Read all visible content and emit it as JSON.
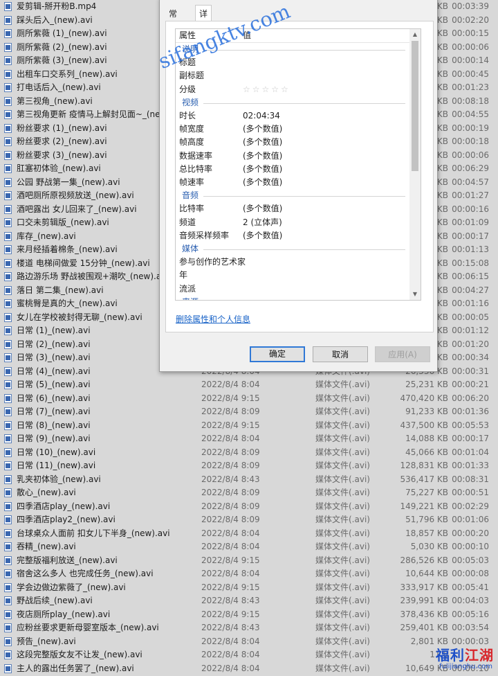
{
  "files": [
    {
      "name": "爱剪辑-掰开粉B.mp4",
      "date": "",
      "type": "",
      "size": "KB",
      "duration": "00:03:39"
    },
    {
      "name": "踩头后入_(new).avi",
      "date": "",
      "type": "",
      "size": "KB",
      "duration": "00:02:20"
    },
    {
      "name": "厕所紫薇 (1)_(new).avi",
      "date": "",
      "type": "",
      "size": "KB",
      "duration": "00:00:15"
    },
    {
      "name": "厕所紫薇 (2)_(new).avi",
      "date": "",
      "type": "",
      "size": "KB",
      "duration": "00:00:06"
    },
    {
      "name": "厕所紫薇 (3)_(new).avi",
      "date": "",
      "type": "",
      "size": "KB",
      "duration": "00:00:14"
    },
    {
      "name": "出租车口交系列_(new).avi",
      "date": "",
      "type": "",
      "size": "KB",
      "duration": "00:00:45"
    },
    {
      "name": "打电话后入_(new).avi",
      "date": "",
      "type": "",
      "size": "KB",
      "duration": "00:01:23"
    },
    {
      "name": "第三视角_(new).avi",
      "date": "",
      "type": "",
      "size": "KB",
      "duration": "00:08:18"
    },
    {
      "name": "第三视角更新 疫情马上解封见面~_(new).avi",
      "date": "",
      "type": "",
      "size": "KB",
      "duration": "00:04:55"
    },
    {
      "name": "粉丝要求 (1)_(new).avi",
      "date": "",
      "type": "",
      "size": "KB",
      "duration": "00:00:19"
    },
    {
      "name": "粉丝要求 (2)_(new).avi",
      "date": "",
      "type": "",
      "size": "KB",
      "duration": "00:00:18"
    },
    {
      "name": "粉丝要求 (3)_(new).avi",
      "date": "",
      "type": "",
      "size": "KB",
      "duration": "00:00:06"
    },
    {
      "name": "肛塞初体验_(new).avi",
      "date": "",
      "type": "",
      "size": "KB",
      "duration": "00:06:29"
    },
    {
      "name": "公园 野战第一集_(new).avi",
      "date": "",
      "type": "",
      "size": "KB",
      "duration": "00:04:57"
    },
    {
      "name": "酒吧厕所原视频放送_(new).avi",
      "date": "",
      "type": "",
      "size": "KB",
      "duration": "00:01:27"
    },
    {
      "name": "酒吧露出 女儿回来了_(new).avi",
      "date": "",
      "type": "",
      "size": "KB",
      "duration": "00:00:16"
    },
    {
      "name": "口交未剪辑版_(new).avi",
      "date": "",
      "type": "",
      "size": "KB",
      "duration": "00:01:09"
    },
    {
      "name": "库存_(new).avi",
      "date": "",
      "type": "",
      "size": "KB",
      "duration": "00:00:17"
    },
    {
      "name": "来月经插着棉条_(new).avi",
      "date": "",
      "type": "",
      "size": "KB",
      "duration": "00:01:13"
    },
    {
      "name": "楼道 电梯间做爱 15分钟_(new).avi",
      "date": "",
      "type": "",
      "size": "KB",
      "duration": "00:15:08"
    },
    {
      "name": "路边游乐场 野战被围观+潮吹_(new).avi",
      "date": "",
      "type": "",
      "size": "KB",
      "duration": "00:06:15"
    },
    {
      "name": "落日 第二集_(new).avi",
      "date": "",
      "type": "",
      "size": "KB",
      "duration": "00:04:27"
    },
    {
      "name": "蜜桃臀是真的大_(new).avi",
      "date": "",
      "type": "",
      "size": "KB",
      "duration": "00:01:16"
    },
    {
      "name": "女儿在学校被封得无聊_(new).avi",
      "date": "",
      "type": "",
      "size": "KB",
      "duration": "00:00:05"
    },
    {
      "name": "日常 (1)_(new).avi",
      "date": "",
      "type": "",
      "size": "KB",
      "duration": "00:01:12"
    },
    {
      "name": "日常 (2)_(new).avi",
      "date": "",
      "type": "",
      "size": "KB",
      "duration": "00:01:20"
    },
    {
      "name": "日常 (3)_(new).avi",
      "date": "",
      "type": "",
      "size": "KB",
      "duration": "00:00:34"
    },
    {
      "name": "日常 (4)_(new).avi",
      "date": "2022/8/4 8:04",
      "type": "媒体文件(.avi)",
      "size": "26,336 KB",
      "duration": "00:00:31"
    },
    {
      "name": "日常 (5)_(new).avi",
      "date": "2022/8/4 8:04",
      "type": "媒体文件(.avi)",
      "size": "25,231 KB",
      "duration": "00:00:21"
    },
    {
      "name": "日常 (6)_(new).avi",
      "date": "2022/8/4 9:15",
      "type": "媒体文件(.avi)",
      "size": "470,420 KB",
      "duration": "00:06:20"
    },
    {
      "name": "日常 (7)_(new).avi",
      "date": "2022/8/4 8:09",
      "type": "媒体文件(.avi)",
      "size": "91,233 KB",
      "duration": "00:01:36"
    },
    {
      "name": "日常 (8)_(new).avi",
      "date": "2022/8/4 9:15",
      "type": "媒体文件(.avi)",
      "size": "437,500 KB",
      "duration": "00:05:53"
    },
    {
      "name": "日常 (9)_(new).avi",
      "date": "2022/8/4 8:04",
      "type": "媒体文件(.avi)",
      "size": "14,088 KB",
      "duration": "00:00:17"
    },
    {
      "name": "日常 (10)_(new).avi",
      "date": "2022/8/4 8:09",
      "type": "媒体文件(.avi)",
      "size": "45,066 KB",
      "duration": "00:01:04"
    },
    {
      "name": "日常 (11)_(new).avi",
      "date": "2022/8/4 8:09",
      "type": "媒体文件(.avi)",
      "size": "128,831 KB",
      "duration": "00:01:33"
    },
    {
      "name": "乳夹初体验_(new).avi",
      "date": "2022/8/4 8:43",
      "type": "媒体文件(.avi)",
      "size": "536,417 KB",
      "duration": "00:08:31"
    },
    {
      "name": "散心_(new).avi",
      "date": "2022/8/4 8:09",
      "type": "媒体文件(.avi)",
      "size": "75,227 KB",
      "duration": "00:00:51"
    },
    {
      "name": "四季酒店play_(new).avi",
      "date": "2022/8/4 8:09",
      "type": "媒体文件(.avi)",
      "size": "149,221 KB",
      "duration": "00:02:29"
    },
    {
      "name": "四季酒店play2_(new).avi",
      "date": "2022/8/4 8:09",
      "type": "媒体文件(.avi)",
      "size": "51,796 KB",
      "duration": "00:01:06"
    },
    {
      "name": "台球桌众人面前 扣女儿下半身_(new).avi",
      "date": "2022/8/4 8:04",
      "type": "媒体文件(.avi)",
      "size": "18,857 KB",
      "duration": "00:00:20"
    },
    {
      "name": "吞精_(new).avi",
      "date": "2022/8/4 8:04",
      "type": "媒体文件(.avi)",
      "size": "5,030 KB",
      "duration": "00:00:10"
    },
    {
      "name": "完整版福利放送_(new).avi",
      "date": "2022/8/4 9:15",
      "type": "媒体文件(.avi)",
      "size": "286,526 KB",
      "duration": "00:05:03"
    },
    {
      "name": "宿舍这么多人 也完成任务_(new).avi",
      "date": "2022/8/4 8:04",
      "type": "媒体文件(.avi)",
      "size": "10,644 KB",
      "duration": "00:00:08"
    },
    {
      "name": "学会边做边紫薇了_(new).avi",
      "date": "2022/8/4 9:15",
      "type": "媒体文件(.avi)",
      "size": "333,917 KB",
      "duration": "00:05:41"
    },
    {
      "name": "野战后续_(new).avi",
      "date": "2022/8/4 8:43",
      "type": "媒体文件(.avi)",
      "size": "239,991 KB",
      "duration": "00:04:03"
    },
    {
      "name": "夜店厕所play_(new).avi",
      "date": "2022/8/4 9:15",
      "type": "媒体文件(.avi)",
      "size": "378,436 KB",
      "duration": "00:05:16"
    },
    {
      "name": "应粉丝要求更新母婴室版本_(new).avi",
      "date": "2022/8/4 8:43",
      "type": "媒体文件(.avi)",
      "size": "259,401 KB",
      "duration": "00:03:54"
    },
    {
      "name": "预告_(new).avi",
      "date": "2022/8/4 8:04",
      "type": "媒体文件(.avi)",
      "size": "2,801 KB",
      "duration": "00:00:03"
    },
    {
      "name": "这段完整版女友不让发_(new).avi",
      "date": "2022/8/4 8:04",
      "type": "媒体文件(.avi)",
      "size": "11,8",
      "duration": ""
    },
    {
      "name": "主人的露出任务罢了_(new).avi",
      "date": "2022/8/4 8:04",
      "type": "媒体文件(.avi)",
      "size": "10,649 KB",
      "duration": "00:00:10"
    }
  ],
  "dialog": {
    "tabs": [
      "常规",
      "详细信息"
    ],
    "active_tab": 1,
    "grid_header": {
      "property": "属性",
      "value": "值"
    },
    "rows": [
      {
        "kind": "section",
        "label": "说明"
      },
      {
        "kind": "prop",
        "name": "标题",
        "value": ""
      },
      {
        "kind": "prop",
        "name": "副标题",
        "value": ""
      },
      {
        "kind": "prop",
        "name": "分级",
        "value": "",
        "stars": "☆☆☆☆☆"
      },
      {
        "kind": "section",
        "label": "视频"
      },
      {
        "kind": "prop",
        "name": "时长",
        "value": "02:04:34"
      },
      {
        "kind": "prop",
        "name": "帧宽度",
        "value": "(多个数值)"
      },
      {
        "kind": "prop",
        "name": "帧高度",
        "value": "(多个数值)"
      },
      {
        "kind": "prop",
        "name": "数据速率",
        "value": "(多个数值)"
      },
      {
        "kind": "prop",
        "name": "总比特率",
        "value": "(多个数值)"
      },
      {
        "kind": "prop",
        "name": "帧速率",
        "value": "(多个数值)"
      },
      {
        "kind": "section",
        "label": "音频"
      },
      {
        "kind": "prop",
        "name": "比特率",
        "value": "(多个数值)"
      },
      {
        "kind": "prop",
        "name": "频道",
        "value": "2 (立体声)"
      },
      {
        "kind": "prop",
        "name": "音频采样频率",
        "value": "(多个数值)"
      },
      {
        "kind": "section",
        "label": "媒体"
      },
      {
        "kind": "prop",
        "name": "参与创作的艺术家",
        "value": ""
      },
      {
        "kind": "prop",
        "name": "年",
        "value": ""
      },
      {
        "kind": "prop",
        "name": "流派",
        "value": ""
      },
      {
        "kind": "section",
        "label": "来源"
      }
    ],
    "remove_link": "删除属性和个人信息",
    "buttons": {
      "ok": "确定",
      "cancel": "取消",
      "apply": "应用(A)"
    }
  },
  "watermark": "sifangktv.com",
  "logo": {
    "text_a": "福利",
    "text_b": "江湖",
    "domain": "fulijianghu.com"
  },
  "colors": {
    "accent": "#2f78d6",
    "section": "#2a5fb0",
    "link": "#1a64c8",
    "watermark": "#286edc"
  }
}
